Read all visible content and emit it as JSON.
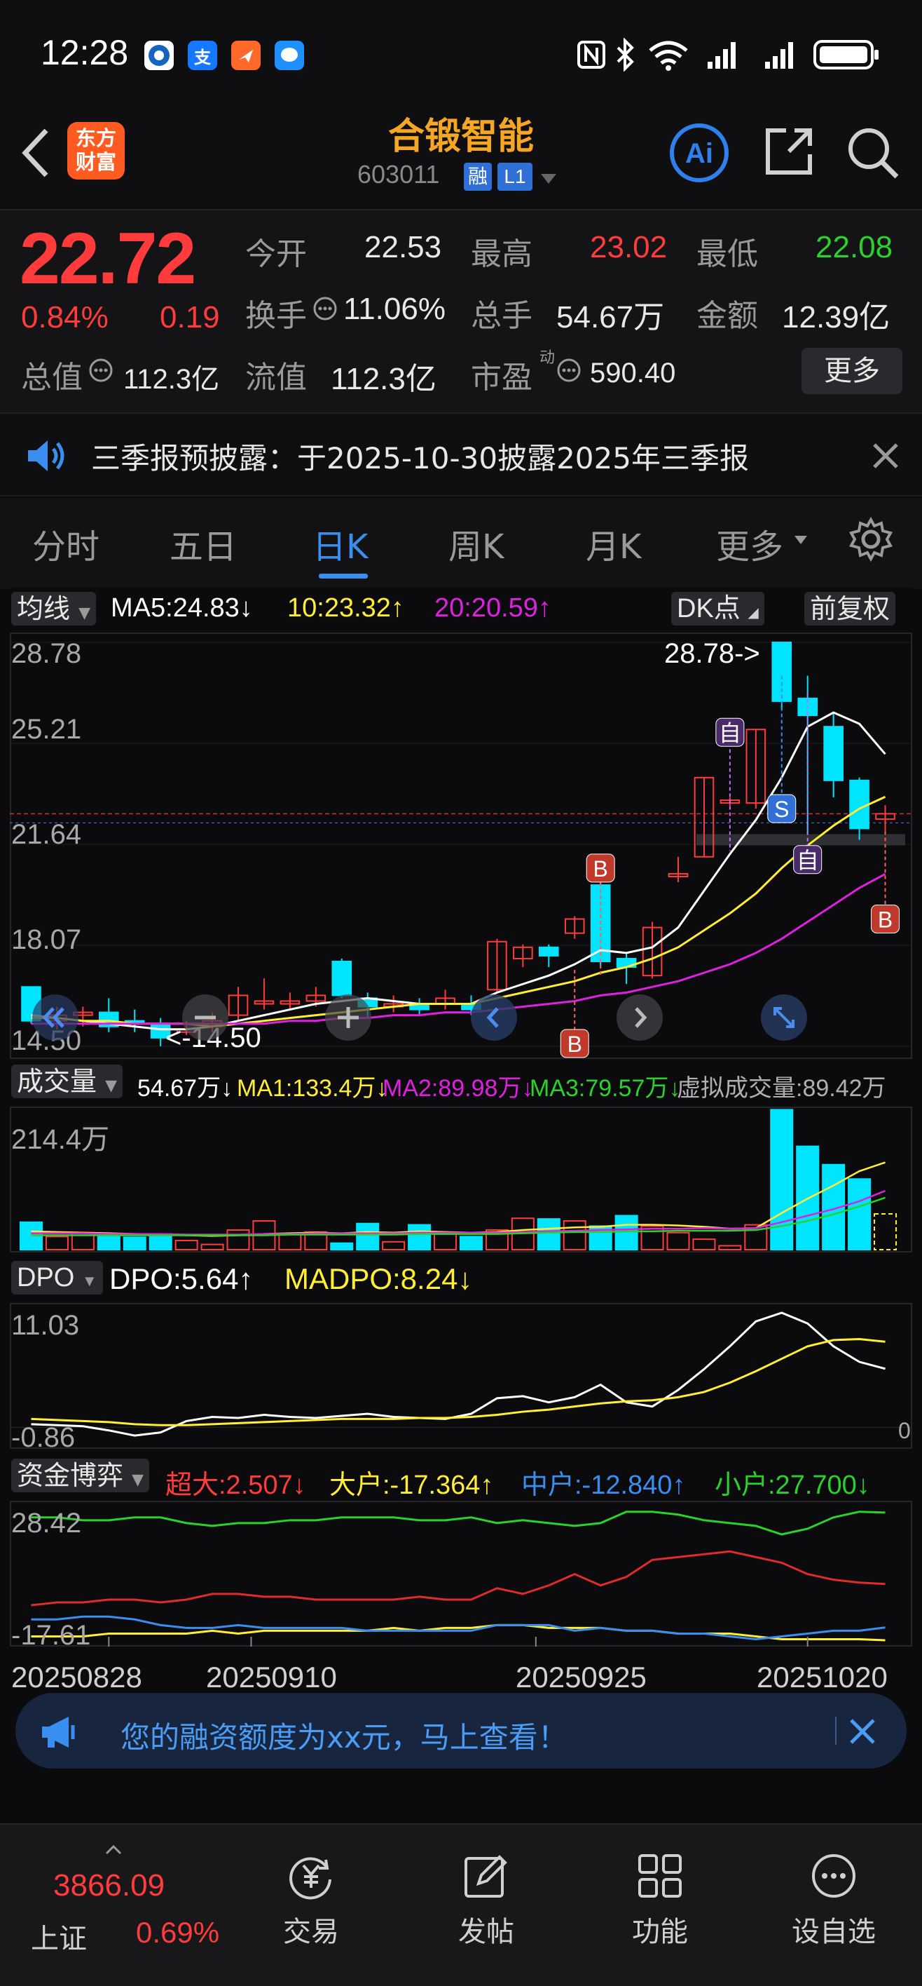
{
  "status_bar": {
    "time": "12:28",
    "apps": [
      "支"
    ]
  },
  "header": {
    "back_label": "back",
    "logo_line1": "东方",
    "logo_line2": "财富",
    "title": "合锻智能",
    "code": "603011",
    "tag_margin": "融",
    "tag_level": "L1"
  },
  "quote": {
    "price": "22.72",
    "change_pct": "0.84%",
    "change_amt": "0.19",
    "stats": [
      {
        "label": "今开",
        "value": "22.53",
        "color": "#e8e8e8"
      },
      {
        "label": "最高",
        "value": "23.02",
        "color": "#ff3b3b"
      },
      {
        "label": "最低",
        "value": "22.08",
        "color": "#2bd12b"
      },
      {
        "label": "换手",
        "value": "11.06%",
        "color": "#e8e8e8"
      },
      {
        "label": "总手",
        "value": "54.67万",
        "color": "#e8e8e8"
      },
      {
        "label": "金额",
        "value": "12.39亿",
        "color": "#e8e8e8"
      },
      {
        "label": "总值",
        "value": "112.3亿",
        "color": "#e8e8e8"
      },
      {
        "label": "流值",
        "value": "112.3亿",
        "color": "#e8e8e8"
      },
      {
        "label": "市盈",
        "value": "590.40",
        "color": "#e8e8e8"
      }
    ],
    "pe_superscript": "动",
    "more_label": "更多"
  },
  "notice": {
    "text": "三季报预披露：于2025-10-30披露2025年三季报"
  },
  "tabs": {
    "items": [
      "分时",
      "五日",
      "日K",
      "周K",
      "月K",
      "更多"
    ],
    "active": "日K"
  },
  "kline": {
    "indicator_select": "均线",
    "ma5": "MA5:24.83↓",
    "ma10": "10:23.32↑",
    "ma20": "20:20.59↑",
    "dk_label": "DK点",
    "adjust_label": "前复权",
    "y_labels": [
      "28.78",
      "25.21",
      "21.64",
      "18.07",
      "14.50"
    ],
    "high_marker": "28.78->",
    "low_marker": "<-14.50",
    "marker_b": "B",
    "marker_s": "S",
    "marker_zi": "自"
  },
  "volume": {
    "indicator_select": "成交量",
    "vol": "54.67万↓",
    "ma1": "MA1:133.4万↓",
    "ma2": "MA2:89.98万↓",
    "ma3": "MA3:79.57万↓",
    "virtual": "虚拟成交量:89.42万",
    "y_label": "214.4万"
  },
  "dpo": {
    "indicator_select": "DPO",
    "dpo": "DPO:5.64↑",
    "madpo": "MADPO:8.24↓",
    "y_top": "11.03",
    "y_bottom": "-0.86",
    "zero": "0"
  },
  "fund": {
    "indicator_select": "资金博弈",
    "super": "超大:2.507↓",
    "large": "大户:-17.364↑",
    "medium": "中户:-12.840↑",
    "small": "小户:27.700↓",
    "y_top": "28.42",
    "y_bottom": "-17.61"
  },
  "dates": [
    "20250828",
    "20250910",
    "20250925",
    "20251020"
  ],
  "promo": {
    "text": "您的融资额度为xx元，马上查看！"
  },
  "bottom_nav": {
    "index_value": "3866.09",
    "index_name": "上证",
    "index_change": "0.69%",
    "items": [
      "交易",
      "发帖",
      "功能",
      "设自选"
    ]
  },
  "colors": {
    "up": "#ff3b3b",
    "down": "#00e5ff",
    "ma5": "#ffffff",
    "ma10": "#ffee33",
    "ma20": "#e020e0",
    "accent": "#3a8ef0",
    "title": "#f5a623"
  },
  "chart_data": [
    {
      "type": "candlestick",
      "title": "日K",
      "ylim": [
        14.5,
        28.78
      ],
      "y_ticks": [
        28.78,
        25.21,
        21.64,
        18.07,
        14.5
      ],
      "x_ticks": [
        "20250828",
        "20250910",
        "20250925",
        "20251020"
      ],
      "candles": [
        {
          "o": 16.6,
          "c": 15.4,
          "h": 16.6,
          "l": 15.3
        },
        {
          "o": 15.4,
          "c": 15.6,
          "h": 15.9,
          "l": 15.1
        },
        {
          "o": 15.6,
          "c": 15.7,
          "h": 15.9,
          "l": 15.2
        },
        {
          "o": 15.7,
          "c": 15.2,
          "h": 16.2,
          "l": 15.0
        },
        {
          "o": 15.4,
          "c": 15.3,
          "h": 15.8,
          "l": 15.0
        },
        {
          "o": 15.3,
          "c": 14.8,
          "h": 15.5,
          "l": 14.5
        },
        {
          "o": 15.0,
          "c": 15.1,
          "h": 15.4,
          "l": 14.9
        },
        {
          "o": 15.2,
          "c": 15.4,
          "h": 15.7,
          "l": 15.0
        },
        {
          "o": 15.6,
          "c": 16.3,
          "h": 16.6,
          "l": 15.4
        },
        {
          "o": 16.0,
          "c": 16.1,
          "h": 16.9,
          "l": 15.8
        },
        {
          "o": 16.0,
          "c": 16.1,
          "h": 16.4,
          "l": 15.8
        },
        {
          "o": 16.1,
          "c": 16.3,
          "h": 16.6,
          "l": 15.9
        },
        {
          "o": 17.5,
          "c": 16.3,
          "h": 17.6,
          "l": 16.2
        },
        {
          "o": 16.2,
          "c": 15.9,
          "h": 16.4,
          "l": 15.5
        },
        {
          "o": 15.9,
          "c": 16.0,
          "h": 16.3,
          "l": 15.7
        },
        {
          "o": 16.0,
          "c": 15.8,
          "h": 16.2,
          "l": 15.6
        },
        {
          "o": 16.0,
          "c": 16.2,
          "h": 16.5,
          "l": 15.8
        },
        {
          "o": 16.0,
          "c": 15.8,
          "h": 16.3,
          "l": 15.6
        },
        {
          "o": 16.5,
          "c": 18.2,
          "h": 18.3,
          "l": 16.4
        },
        {
          "o": 17.6,
          "c": 18.0,
          "h": 18.1,
          "l": 17.3
        },
        {
          "o": 18.0,
          "c": 17.7,
          "h": 18.1,
          "l": 17.3
        },
        {
          "o": 18.5,
          "c": 19.0,
          "h": 19.1,
          "l": 18.3
        },
        {
          "o": 20.2,
          "c": 17.5,
          "h": 20.5,
          "l": 17.3
        },
        {
          "o": 17.6,
          "c": 17.3,
          "h": 17.8,
          "l": 16.7
        },
        {
          "o": 17.0,
          "c": 18.7,
          "h": 18.9,
          "l": 16.9
        },
        {
          "o": 20.5,
          "c": 20.6,
          "h": 21.2,
          "l": 20.3
        },
        {
          "o": 21.2,
          "c": 24.0,
          "h": 24.0,
          "l": 21.2
        },
        {
          "o": 23.1,
          "c": 23.2,
          "h": 23.3,
          "l": 23.0
        },
        {
          "o": 23.1,
          "c": 25.7,
          "h": 25.7,
          "l": 22.9
        },
        {
          "o": 28.78,
          "c": 26.7,
          "h": 28.78,
          "l": 26.4
        },
        {
          "o": 26.8,
          "c": 26.2,
          "h": 27.6,
          "l": 22.0
        },
        {
          "o": 25.8,
          "c": 23.9,
          "h": 26.3,
          "l": 23.3
        },
        {
          "o": 23.9,
          "c": 22.2,
          "h": 24.0,
          "l": 21.8
        },
        {
          "o": 22.53,
          "c": 22.72,
          "h": 23.02,
          "l": 22.08
        }
      ],
      "ma_series": [
        {
          "name": "MA5",
          "values": [
            15.6,
            15.5,
            15.4,
            15.3,
            15.2,
            15.1,
            15.1,
            15.2,
            15.4,
            15.6,
            15.8,
            16.0,
            16.1,
            16.2,
            16.1,
            16.0,
            16.0,
            16.0,
            16.4,
            16.7,
            17.0,
            17.4,
            17.9,
            17.8,
            18.0,
            18.7,
            20.0,
            21.3,
            22.5,
            24.0,
            25.8,
            26.3,
            25.9,
            24.83
          ]
        },
        {
          "name": "MA10",
          "values": [
            15.5,
            15.5,
            15.4,
            15.4,
            15.3,
            15.3,
            15.3,
            15.2,
            15.3,
            15.4,
            15.5,
            15.6,
            15.7,
            15.8,
            15.9,
            16.0,
            16.0,
            16.0,
            16.2,
            16.4,
            16.6,
            16.8,
            17.1,
            17.3,
            17.6,
            18.0,
            18.6,
            19.2,
            19.9,
            20.8,
            21.6,
            22.3,
            22.9,
            23.32
          ]
        },
        {
          "name": "MA20",
          "values": [
            15.3,
            15.3,
            15.3,
            15.3,
            15.3,
            15.3,
            15.3,
            15.3,
            15.3,
            15.3,
            15.4,
            15.4,
            15.5,
            15.5,
            15.6,
            15.6,
            15.7,
            15.7,
            15.8,
            15.9,
            16.0,
            16.1,
            16.3,
            16.4,
            16.6,
            16.8,
            17.1,
            17.4,
            17.8,
            18.3,
            18.9,
            19.5,
            20.1,
            20.59
          ]
        }
      ]
    },
    {
      "type": "bar",
      "title": "成交量",
      "ylim": [
        0,
        214.4
      ],
      "values": [
        42,
        20,
        26,
        22,
        19,
        24,
        14,
        8,
        30,
        44,
        23,
        27,
        10,
        40,
        12,
        38,
        24,
        20,
        30,
        48,
        47,
        44,
        36,
        52,
        36,
        26,
        16,
        6,
        38,
        214,
        158,
        130,
        108,
        54.67
      ],
      "ma_series": [
        {
          "name": "MA1",
          "values": [
            28,
            27,
            26,
            25,
            24,
            23,
            22,
            21,
            22,
            24,
            25,
            26,
            25,
            27,
            26,
            28,
            27,
            26,
            27,
            30,
            32,
            34,
            35,
            38,
            38,
            37,
            35,
            32,
            33,
            56,
            78,
            98,
            120,
            133.4
          ]
        },
        {
          "name": "MA2",
          "values": [
            25,
            25,
            25,
            24,
            24,
            24,
            23,
            23,
            23,
            24,
            24,
            25,
            25,
            25,
            25,
            26,
            26,
            26,
            26,
            27,
            28,
            29,
            30,
            31,
            32,
            32,
            33,
            32,
            33,
            42,
            52,
            62,
            74,
            89.98
          ]
        },
        {
          "name": "MA3",
          "values": [
            22,
            22,
            22,
            22,
            22,
            22,
            22,
            22,
            22,
            22,
            23,
            23,
            23,
            23,
            23,
            24,
            24,
            24,
            24,
            25,
            26,
            27,
            27,
            28,
            28,
            29,
            29,
            29,
            30,
            36,
            44,
            54,
            66,
            79.57
          ]
        }
      ]
    },
    {
      "type": "line",
      "title": "DPO",
      "ylim": [
        -0.86,
        11.03
      ],
      "series": [
        {
          "name": "DPO",
          "values": [
            0.3,
            0.2,
            0.1,
            -0.3,
            -0.8,
            -0.5,
            0.6,
            1.0,
            0.9,
            1.2,
            1.0,
            0.9,
            1.1,
            1.3,
            1.0,
            0.9,
            0.8,
            1.3,
            2.8,
            3.0,
            2.4,
            2.9,
            4.1,
            2.4,
            2.0,
            3.6,
            5.6,
            7.8,
            10.2,
            11.03,
            10.0,
            7.8,
            6.3,
            5.64
          ]
        },
        {
          "name": "MADPO",
          "values": [
            0.8,
            0.7,
            0.6,
            0.5,
            0.3,
            0.2,
            0.2,
            0.3,
            0.4,
            0.5,
            0.6,
            0.7,
            0.8,
            0.8,
            0.8,
            0.9,
            0.9,
            1.0,
            1.2,
            1.5,
            1.7,
            2.0,
            2.3,
            2.5,
            2.6,
            2.9,
            3.4,
            4.3,
            5.4,
            6.6,
            7.8,
            8.4,
            8.5,
            8.24
          ]
        }
      ]
    },
    {
      "type": "line",
      "title": "资金博弈",
      "ylim": [
        -17.61,
        28.42
      ],
      "series": [
        {
          "name": "超大",
          "values": [
            -5,
            -4,
            -4,
            -3,
            -3,
            -4,
            -3,
            -1,
            -1,
            -2,
            -2,
            -3,
            -3,
            -3,
            -3,
            -2,
            -3,
            -3,
            1,
            -1,
            2,
            6,
            2,
            5,
            11,
            12,
            13,
            14,
            12,
            10,
            6,
            4,
            3,
            2.507
          ]
        },
        {
          "name": "大户",
          "values": [
            -16,
            -16,
            -16,
            -15,
            -15,
            -15,
            -15,
            -14,
            -15,
            -14,
            -14,
            -14,
            -14,
            -14,
            -13,
            -14,
            -13,
            -13,
            -12,
            -12,
            -13,
            -13,
            -13,
            -14,
            -14,
            -15,
            -15,
            -15,
            -16,
            -17,
            -17,
            -17,
            -17,
            -17.364
          ]
        },
        {
          "name": "中户",
          "values": [
            -10,
            -10,
            -9,
            -9,
            -10,
            -12,
            -13,
            -13,
            -12,
            -13,
            -13,
            -13,
            -13,
            -14,
            -14,
            -14,
            -14,
            -14,
            -12,
            -12,
            -12,
            -14,
            -13,
            -14,
            -14,
            -15,
            -15,
            -16,
            -17,
            -16,
            -15,
            -14,
            -14,
            -12.84
          ]
        },
        {
          "name": "小户",
          "values": [
            26,
            26,
            25,
            25,
            26,
            26,
            24,
            23,
            24,
            24,
            25,
            25,
            26,
            26,
            26,
            25,
            25,
            26,
            24,
            25,
            24,
            23,
            24,
            28,
            28,
            27,
            25,
            24,
            23,
            20,
            22,
            26,
            28,
            27.7
          ]
        }
      ]
    }
  ]
}
